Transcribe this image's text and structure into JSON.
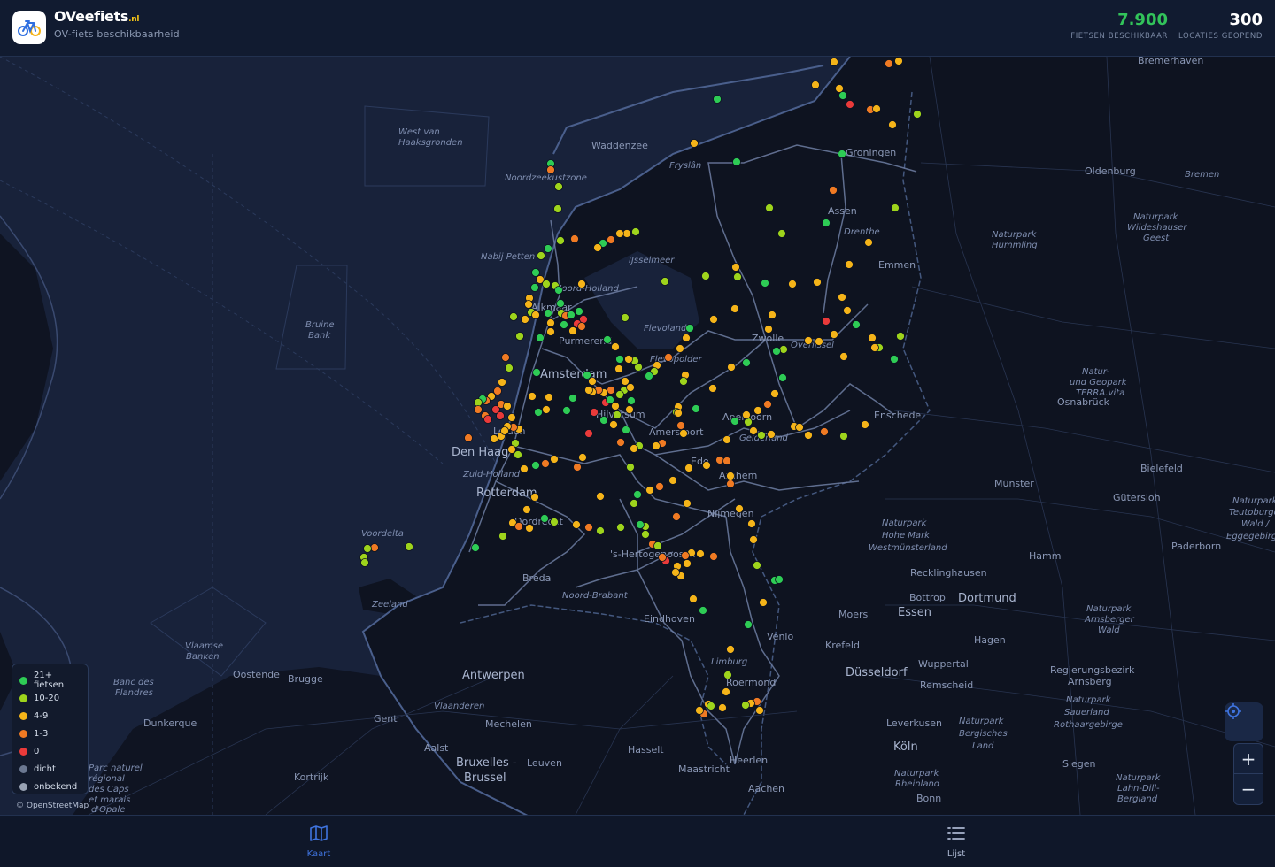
{
  "header": {
    "brand_name": "OVeefiets",
    "brand_tld": ".nl",
    "subtitle": "OV-fiets beschikbaarheid",
    "bikes_value": "7.900",
    "bikes_label": "FIETSEN BESCHIKBAAR",
    "locations_value": "300",
    "locations_label": "LOCATIES GEOPEND",
    "logo_icon": "bicycle-icon"
  },
  "colors": {
    "c21": "#2ecc55",
    "c10": "#9ed41c",
    "c4": "#f5b419",
    "c1": "#f07a23",
    "c0": "#ea3a3a",
    "dicht": "#6b7891",
    "onbekend": "#98a2b3"
  },
  "legend": {
    "items": [
      {
        "label": "21+ fietsen",
        "color": "#2ecc55"
      },
      {
        "label": "10-20",
        "color": "#9ed41c"
      },
      {
        "label": "4-9",
        "color": "#f5b419"
      },
      {
        "label": "1-3",
        "color": "#f07a23"
      },
      {
        "label": "0",
        "color": "#ea3a3a"
      },
      {
        "label": "dicht",
        "color": "#6b7891"
      },
      {
        "label": "onbekend",
        "color": "#98a2b3"
      }
    ]
  },
  "attribution": "© OpenStreetMap",
  "places": {
    "waddenzee": "Waddenzee",
    "west_van": "West van",
    "haaksgronden": "Haaksgronden",
    "noordzeekustzone": "Noordzeekustzone",
    "nabij_petten": "Nabij Petten",
    "ijsselmeer": "IJsselmeer",
    "fryslan": "Fryslân",
    "groningen": "Groningen",
    "assen": "Assen",
    "drenthe": "Drenthe",
    "emmen": "Emmen",
    "noord_holland": "Noord-Holland",
    "alkmaar": "Alkmaar",
    "purmerend": "Purmerend",
    "amsterdam": "Amsterdam",
    "flevoland": "Flevoland",
    "flevopolder": "Flevopolder",
    "zwolle": "Zwolle",
    "overijssel": "Overijssel",
    "hilversum": "Hilversum",
    "leiden": "Leiden",
    "den_haag": "Den Haag",
    "zuid_holland": "Zuid-Holland",
    "rotterdam": "Rotterdam",
    "dordrecht": "Dordrecht",
    "amersfoort": "Amersfoort",
    "apeldoorn": "Apeldoorn",
    "gelderland": "Gelderland",
    "enschede": "Enschede",
    "ede": "Ede",
    "arnhem": "Arnhem",
    "nijmegen": "Nijmegen",
    "den_bosch": "'s-Hertogenbosch",
    "noord_brabant": "Noord-Brabant",
    "eindhoven": "Eindhoven",
    "venlo": "Venlo",
    "limburg": "Limburg",
    "roermond": "Roermond",
    "maastricht": "Maastricht",
    "heerlen": "Heerlen",
    "breda": "Breda",
    "zeeland": "Zeeland",
    "voordelta": "Voordelta",
    "bruine": "Bruine",
    "bank": "Bank",
    "vlaamse": "Vlaamse",
    "banken": "Banken",
    "banc_des": "Banc des",
    "flandres": "Flandres",
    "oostende": "Oostende",
    "brugge": "Brugge",
    "antwerpen": "Antwerpen",
    "vlaanderen": "Vlaanderen",
    "gent": "Gent",
    "mechelen": "Mechelen",
    "aalst": "Aalst",
    "hasselt": "Hasselt",
    "leuven": "Leuven",
    "bruxelles": "Bruxelles -",
    "brussel": "Brussel",
    "kortrijk": "Kortrijk",
    "dunkerque": "Dunkerque",
    "aachen": "Aachen",
    "bremerhaven": "Bremerhaven",
    "oldenburg": "Oldenburg",
    "bremen": "Bremen",
    "osnabruck": "Osnabrück",
    "munster": "Münster",
    "bielefeld": "Bielefeld",
    "gutersloh": "Gütersloh",
    "paderborn": "Paderborn",
    "hamm": "Hamm",
    "dortmund": "Dortmund",
    "essen": "Essen",
    "bottrop": "Bottrop",
    "recklinghausen": "Recklinghausen",
    "moers": "Moers",
    "krefeld": "Krefeld",
    "dusseldorf": "Düsseldorf",
    "wuppertal": "Wuppertal",
    "remscheid": "Remscheid",
    "hagen": "Hagen",
    "leverkusen": "Leverkusen",
    "koln": "Köln",
    "bonn": "Bonn",
    "siegen": "Siegen",
    "np_hohe_mark": "Naturpark",
    "hohe_mark": "Hohe Mark",
    "westmunsterland": "Westmünsterland",
    "np_hummling": "Naturpark",
    "hummling": "Hummling",
    "np_wildeshauser": "Naturpark",
    "wildeshauser": "Wildeshauser",
    "geest": "Geest",
    "terra_natur": "Natur-",
    "terra_geopark": "und Geopark",
    "terra_vita": "TERRA.vita",
    "np_bergisches": "Naturpark",
    "bergisches": "Bergisches",
    "land": "Land",
    "np_sauerland": "Naturpark",
    "sauerland": "Sauerland",
    "rothaargebirge": "Rothaargebirge",
    "np_arnsberger": "Naturpark",
    "arnsberger": "Arnsberger",
    "wald": "Wald",
    "regierungsbezirk": "Regierungsbezirk",
    "arnsberg": "Arnsberg",
    "np_rheinland": "Naturpark",
    "rheinland": "Rheinland",
    "np_lahn": "Naturpark",
    "lahn_dill": "Lahn-Dill-",
    "bergland": "Bergland",
    "teutoburger": "Naturpark",
    "teutoburger2": "Teutoburger",
    "teutoburger3": "Wald /",
    "teutoburger4": "Eggegebirge",
    "marais1": "Parc naturel",
    "marais2": "régional",
    "marais3": "des Caps",
    "marais4": "et marais",
    "marais5": "d'Opale"
  },
  "controls": {
    "locate_icon": "crosshair-icon",
    "zoom_in": "+",
    "zoom_out": "−"
  },
  "nav": {
    "map_label": "Kaart",
    "map_icon": "map-icon",
    "list_label": "Lijst",
    "list_icon": "list-icon"
  }
}
